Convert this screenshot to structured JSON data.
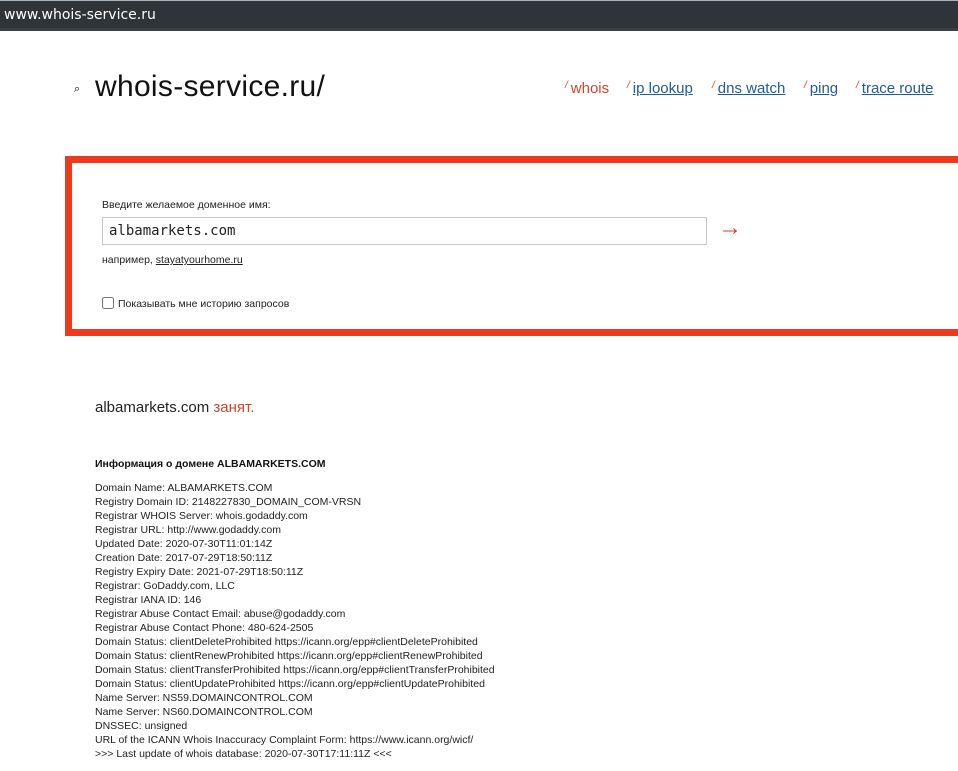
{
  "browser": {
    "address": "www.whois-service.ru"
  },
  "header": {
    "logo_icon": "⌕",
    "logo": "whois-service.ru/",
    "nav": [
      {
        "label": "whois",
        "active": true
      },
      {
        "label": "ip lookup",
        "active": false
      },
      {
        "label": "dns watch",
        "active": false
      },
      {
        "label": "ping",
        "active": false
      },
      {
        "label": "trace route",
        "active": false
      }
    ]
  },
  "search": {
    "label": "Введите желаемое доменное имя:",
    "value": "albamarkets.com",
    "submit_icon": "→",
    "example_prefix": "например,",
    "example_link": "stayatyourhome.ru",
    "history_label": "Показывать мне историю запросов",
    "history_checked": false
  },
  "result": {
    "domain": "albamarkets.com",
    "status": "занят.",
    "info_title": "Информация о домене ALBAMARKETS.COM",
    "lines": [
      "Domain Name: ALBAMARKETS.COM",
      "Registry Domain ID: 2148227830_DOMAIN_COM-VRSN",
      "Registrar WHOIS Server: whois.godaddy.com",
      "Registrar URL: http://www.godaddy.com",
      "Updated Date: 2020-07-30T11:01:14Z",
      "Creation Date: 2017-07-29T18:50:11Z",
      "Registry Expiry Date: 2021-07-29T18:50:11Z",
      "Registrar: GoDaddy.com, LLC",
      "Registrar IANA ID: 146",
      "Registrar Abuse Contact Email: abuse@godaddy.com",
      "Registrar Abuse Contact Phone: 480-624-2505",
      "Domain Status: clientDeleteProhibited https://icann.org/epp#clientDeleteProhibited",
      "Domain Status: clientRenewProhibited https://icann.org/epp#clientRenewProhibited",
      "Domain Status: clientTransferProhibited https://icann.org/epp#clientTransferProhibited",
      "Domain Status: clientUpdateProhibited https://icann.org/epp#clientUpdateProhibited",
      "Name Server: NS59.DOMAINCONTROL.COM",
      "Name Server: NS60.DOMAINCONTROL.COM",
      "DNSSEC: unsigned",
      "URL of the ICANN Whois Inaccuracy Complaint Form: https://www.icann.org/wicf/",
      ">>> Last update of whois database: 2020-07-30T17:11:11Z <<<"
    ]
  },
  "colors": {
    "accent": "#ee3a1c",
    "link": "#1f5b9b",
    "status": "#d4432c"
  }
}
